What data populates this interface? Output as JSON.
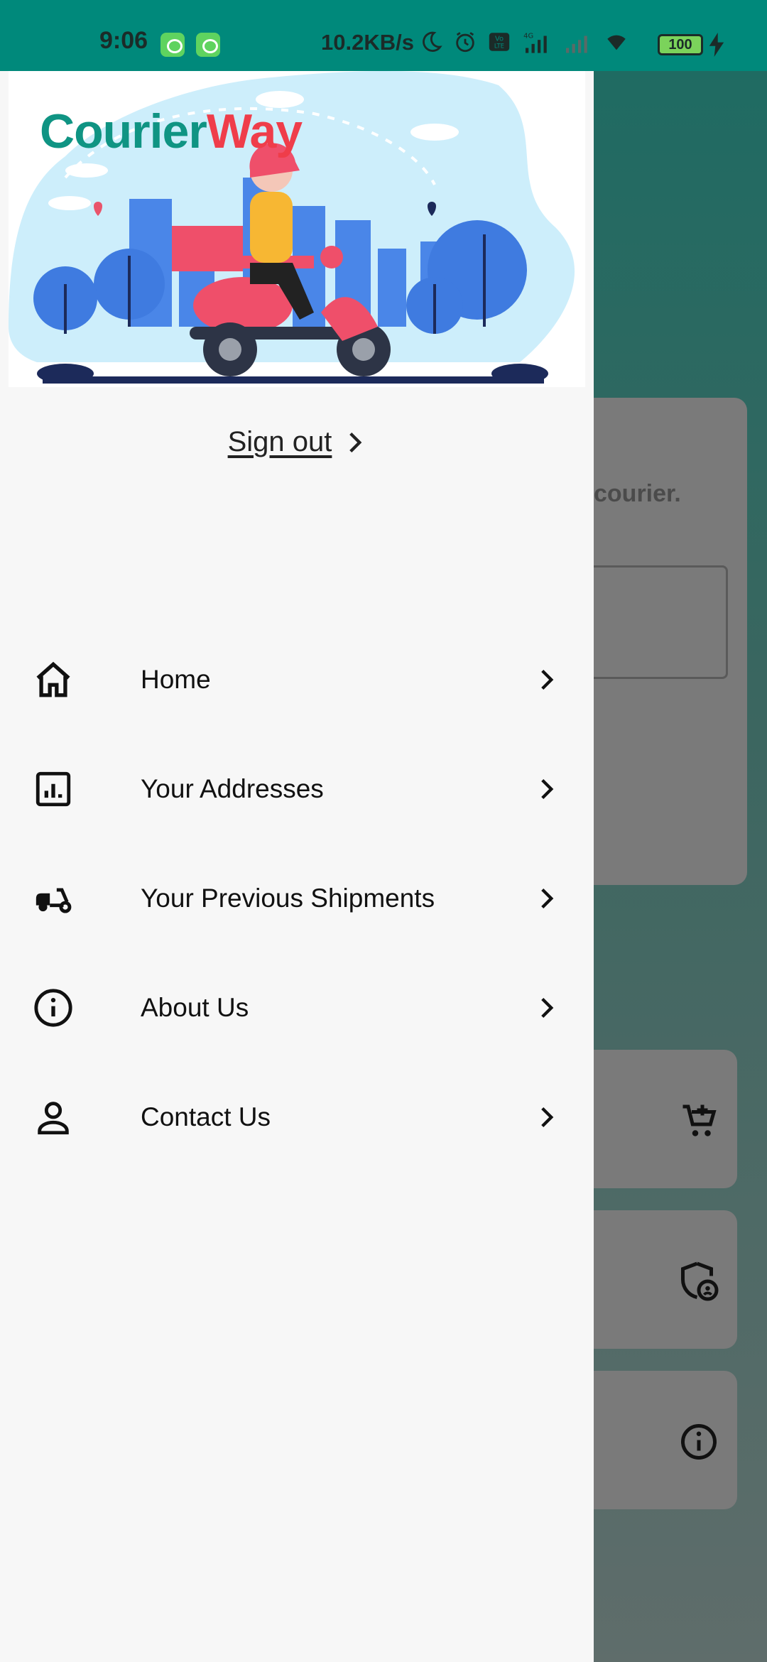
{
  "status_bar": {
    "time": "9:06",
    "network_speed": "10.2KB/s",
    "battery": "100",
    "icons": [
      "app-badge-icon",
      "app-badge-icon",
      "moon-icon",
      "alarm-icon",
      "volte-icon",
      "signal-4g-icon",
      "signal-icon",
      "wifi-icon",
      "battery-icon",
      "charging-icon"
    ]
  },
  "drawer": {
    "logo": {
      "part1": "Courier",
      "part2": "Way"
    },
    "sign_out_label": "Sign out",
    "menu": [
      {
        "label": "Home",
        "icon": "home-icon"
      },
      {
        "label": "Your Addresses",
        "icon": "address-list-icon"
      },
      {
        "label": "Your Previous Shipments",
        "icon": "scooter-icon"
      },
      {
        "label": "About Us",
        "icon": "info-icon"
      },
      {
        "label": "Contact Us",
        "icon": "person-icon"
      }
    ]
  },
  "background": {
    "card_text": "courier.",
    "icons": [
      "add-cart-icon",
      "privacy-shield-icon",
      "info-icon"
    ]
  },
  "colors": {
    "status_bar": "#00897b",
    "logo_primary": "#0f9483",
    "logo_accent": "#ef3d4a",
    "drawer_bg": "#f7f7f7"
  }
}
